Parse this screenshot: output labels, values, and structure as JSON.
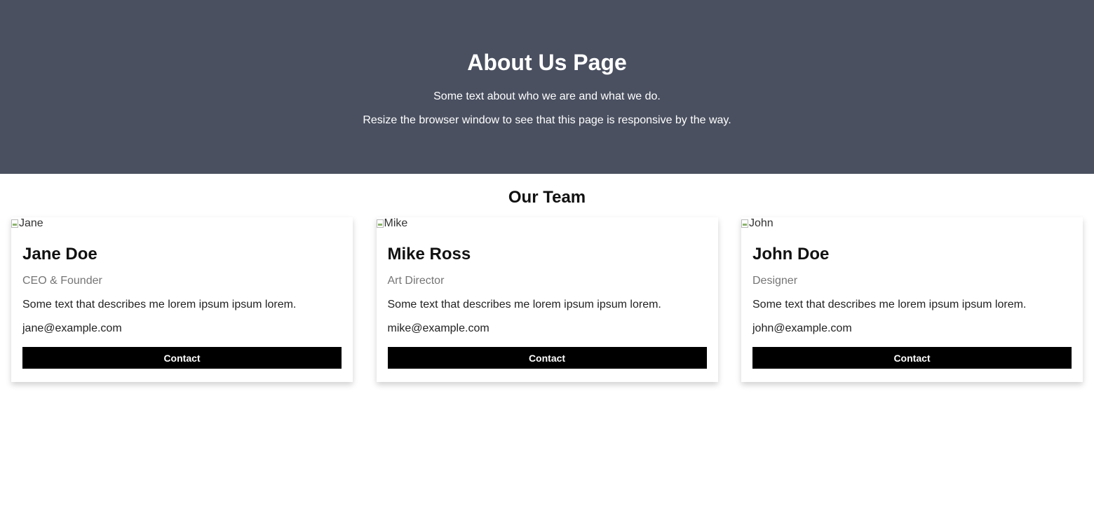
{
  "hero": {
    "title": "About Us Page",
    "line1": "Some text about who we are and what we do.",
    "line2": "Resize the browser window to see that this page is responsive by the way."
  },
  "team": {
    "heading": "Our Team",
    "members": [
      {
        "img_alt": "Jane",
        "name": "Jane Doe",
        "role": "CEO & Founder",
        "description": "Some text that describes me lorem ipsum ipsum lorem.",
        "email": "jane@example.com",
        "button_label": "Contact"
      },
      {
        "img_alt": "Mike",
        "name": "Mike Ross",
        "role": "Art Director",
        "description": "Some text that describes me lorem ipsum ipsum lorem.",
        "email": "mike@example.com",
        "button_label": "Contact"
      },
      {
        "img_alt": "John",
        "name": "John Doe",
        "role": "Designer",
        "description": "Some text that describes me lorem ipsum ipsum lorem.",
        "email": "john@example.com",
        "button_label": "Contact"
      }
    ]
  },
  "colors": {
    "hero_background": "#4a5060",
    "button_background": "#000000",
    "role_text": "#757575"
  },
  "icons": {
    "broken_image": "broken-image-icon"
  }
}
